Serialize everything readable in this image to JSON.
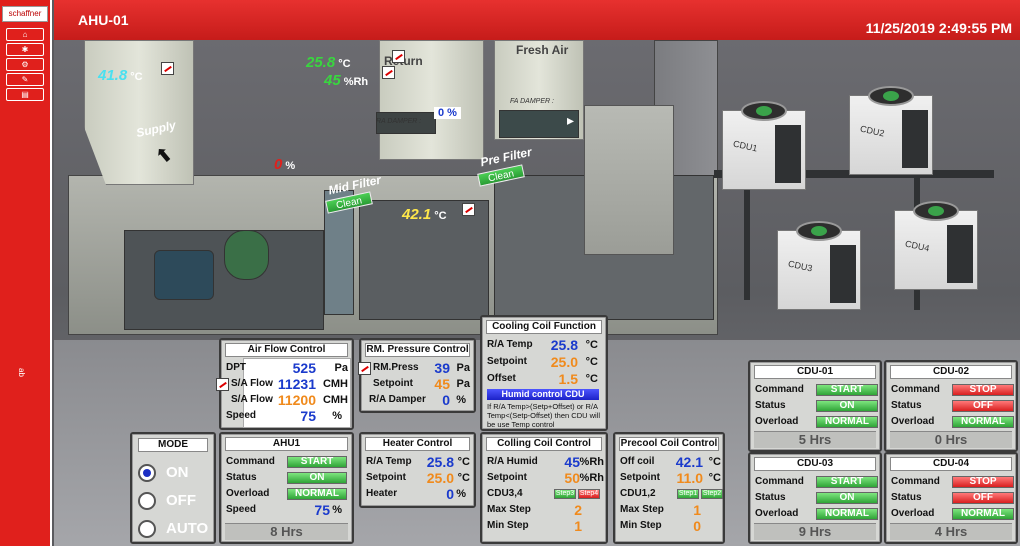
{
  "sidebar": {
    "logo": "schaffner",
    "buttons": [
      "",
      "",
      "",
      "",
      "",
      ""
    ],
    "tag": "ab"
  },
  "header": {
    "title": "AHU-01",
    "datetime": "11/25/2019 2:49:55 PM"
  },
  "scene": {
    "supply_label": "Supply",
    "return_label": "Return",
    "fresh_air_label": "Fresh Air",
    "ra_damper_label": "RA DAMPER :",
    "ra_damper_value": "0 %",
    "fa_damper_label": "FA DAMPER :",
    "supply_temp": "41.8",
    "supply_temp_unit": "°C",
    "return_temp": "25.8",
    "return_temp_unit": "°C",
    "return_rh": "45",
    "return_rh_unit": "%Rh",
    "mid_pct_value": "0",
    "mid_pct_unit": "%",
    "mid_filter_label": "Mid Filter",
    "mid_filter_status": "Clean",
    "pre_filter_label": "Pre Filter",
    "pre_filter_status": "Clean",
    "coil_temp": "42.1",
    "coil_temp_unit": "°C",
    "cdu_labels": [
      "CDU1",
      "CDU2",
      "CDU3",
      "CDU4"
    ]
  },
  "airflow": {
    "title": "Air Flow Control",
    "rows": [
      {
        "label": "DPT",
        "value": "525",
        "unit": "Pa"
      },
      {
        "label": "S/A Flow",
        "value": "11231",
        "unit": "CMH"
      },
      {
        "label": "S/A Flow",
        "value": "11200",
        "unit": "CMH"
      },
      {
        "label": "Speed",
        "value": "75",
        "unit": "%"
      }
    ]
  },
  "rm_press": {
    "title": "RM. Pressure Control",
    "rows": [
      {
        "label": "RM.Press",
        "value": "39",
        "unit": "Pa"
      },
      {
        "label": "Setpoint",
        "value": "45",
        "unit": "Pa"
      },
      {
        "label": "R/A Damper",
        "value": "0",
        "unit": "%"
      }
    ]
  },
  "cooling_fn": {
    "title": "Cooling Coil Function",
    "rows": [
      {
        "label": "R/A Temp",
        "value": "25.8",
        "unit": "°C"
      },
      {
        "label": "Setpoint",
        "value": "25.0",
        "unit": "°C"
      },
      {
        "label": "Offset",
        "value": "1.5",
        "unit": "°C"
      }
    ],
    "button": "Humid control CDU",
    "note": "If R/A Temp>(Setp+Offset) or R/A Temp<(Setp-Offset) then CDU will be use Temp control"
  },
  "mode": {
    "title": "MODE",
    "options": [
      "ON",
      "OFF",
      "AUTO"
    ]
  },
  "ahu1": {
    "title": "AHU1",
    "command_label": "Command",
    "command": "START",
    "status_label": "Status",
    "status": "ON",
    "overload_label": "Overload",
    "overload": "NORMAL",
    "speed_label": "Speed",
    "speed": "75",
    "speed_unit": "%",
    "hrs": "8  Hrs"
  },
  "heater": {
    "title": "Heater Control",
    "rows": [
      {
        "label": "R/A Temp",
        "value": "25.8",
        "unit": "°C"
      },
      {
        "label": "Setpoint",
        "value": "25.0",
        "unit": "°C"
      },
      {
        "label": "Heater",
        "value": "0",
        "unit": "%"
      }
    ]
  },
  "colling": {
    "title": "Colling Coil Control",
    "humid_label": "R/A Humid",
    "humid": "45",
    "humid_unit": "%Rh",
    "setpoint_label": "Setpoint",
    "setpoint": "50",
    "setpoint_unit": "%Rh",
    "cdu_label": "CDU3,4",
    "step_a": "Step3",
    "step_b": "Step4",
    "max_label": "Max Step",
    "max": "2",
    "min_label": "Min Step",
    "min": "1"
  },
  "precool": {
    "title": "Precool Coil Control",
    "off_label": "Off coil",
    "off": "42.1",
    "off_unit": "°C",
    "setpoint_label": "Setpoint",
    "setpoint": "11.0",
    "setpoint_unit": "°C",
    "cdu_label": "CDU1,2",
    "step_a": "Step1",
    "step_b": "Step2",
    "max_label": "Max Step",
    "max": "1",
    "min_label": "Min Step",
    "min": "0"
  },
  "cdus": [
    {
      "title": "CDU-01",
      "command": "START",
      "status": "ON",
      "overload": "NORMAL",
      "hrs": "5  Hrs"
    },
    {
      "title": "CDU-02",
      "command": "STOP",
      "status": "OFF",
      "overload": "NORMAL",
      "hrs": "0  Hrs"
    },
    {
      "title": "CDU-03",
      "command": "START",
      "status": "ON",
      "overload": "NORMAL",
      "hrs": "9  Hrs"
    },
    {
      "title": "CDU-04",
      "command": "STOP",
      "status": "OFF",
      "overload": "NORMAL",
      "hrs": "4  Hrs"
    }
  ],
  "cdu_row_labels": {
    "command": "Command",
    "status": "Status",
    "overload": "Overload"
  },
  "colors": {
    "banner": "#e0201c",
    "green": "#2fa437",
    "red": "#d91f1f",
    "value_blue": "#1a3acc",
    "value_orange": "#f08a1c"
  }
}
